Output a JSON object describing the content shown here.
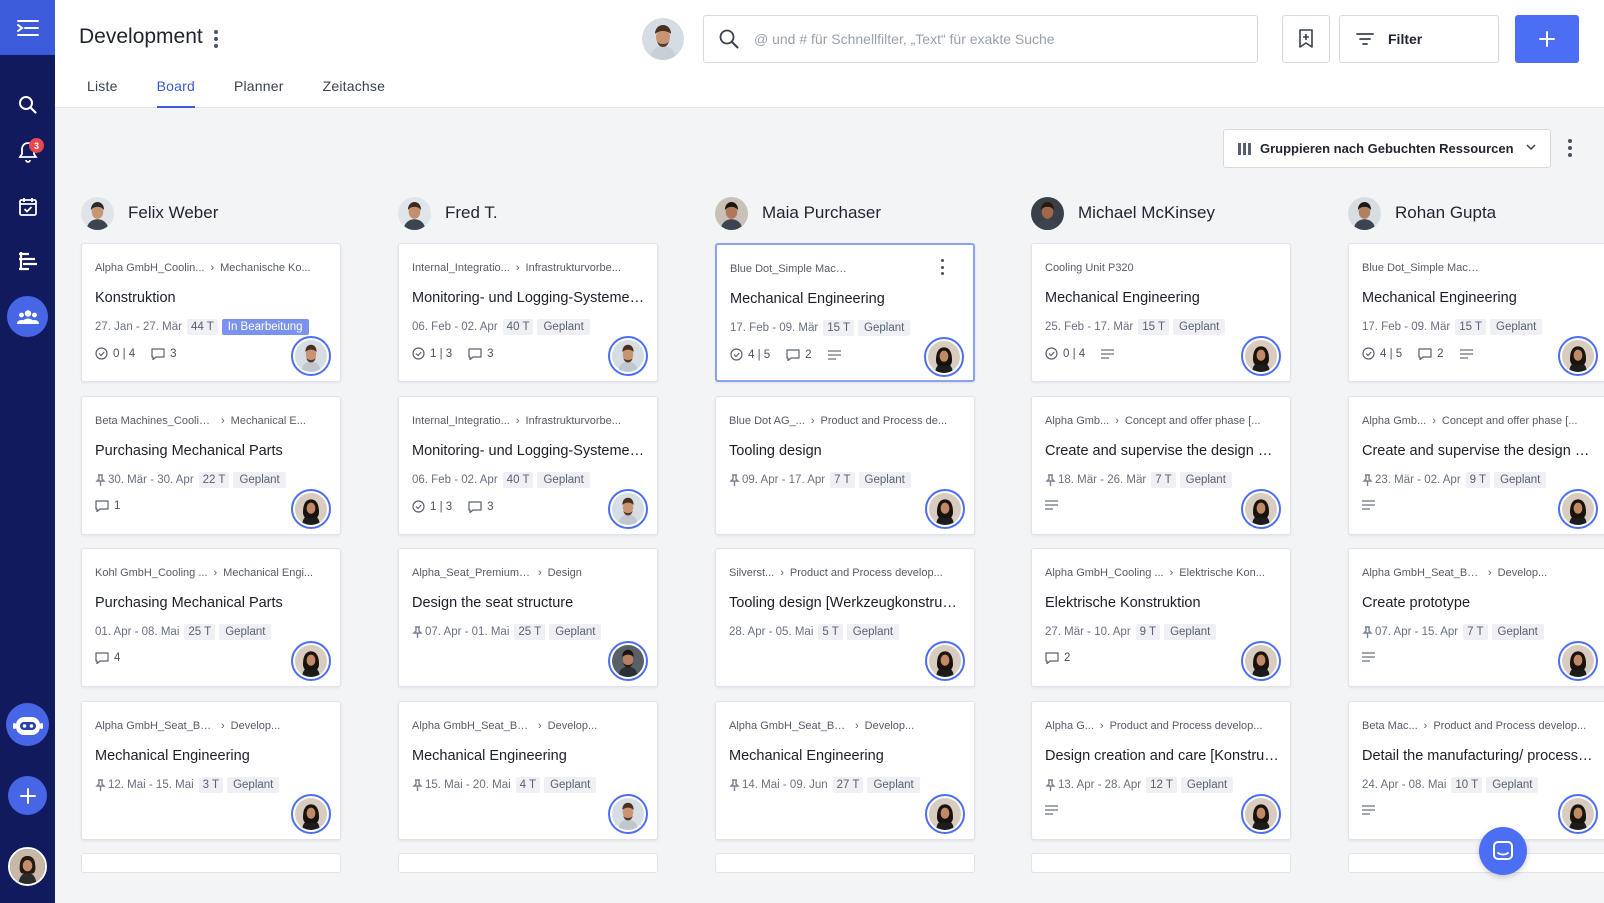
{
  "app": {
    "title": "Development",
    "search_placeholder": "@ und # für Schnellfilter, „Text“ für exakte Suche",
    "filter_label": "Filter",
    "notifications_count": "3",
    "tabs": [
      {
        "label": "Liste",
        "active": false
      },
      {
        "label": "Board",
        "active": true
      },
      {
        "label": "Planner",
        "active": false
      },
      {
        "label": "Zeitachse",
        "active": false
      }
    ],
    "group_by_label": "Gruppieren nach Gebuchten Ressourcen"
  },
  "colors": {
    "sidebar": "#101a5c",
    "accent": "#4c6ef5",
    "status_active": "#7b93ee"
  },
  "columns": [
    {
      "name": "Felix Weber",
      "cards": [
        {
          "crumb1": "Alpha GmbH_Coolin...",
          "crumb2": "Mechanische Ko...",
          "title": "Konstruktion",
          "pinned": false,
          "dates": "27. Jan - 27. Mär",
          "duration": "44 T",
          "status": "In Bearbeitung",
          "status_active": true,
          "checks": "0 | 4",
          "comments": "3",
          "notes": false
        },
        {
          "crumb1": "Beta Machines_Cooling ...",
          "crumb2": "Mechanical E...",
          "title": "Purchasing Mechanical Parts",
          "pinned": true,
          "dates": "30. Mär - 30. Apr",
          "duration": "22 T",
          "status": "Geplant",
          "checks": "",
          "comments": "1",
          "notes": false
        },
        {
          "crumb1": "Kohl GmbH_Cooling ...",
          "crumb2": "Mechanical Engi...",
          "title": "Purchasing Mechanical Parts",
          "pinned": false,
          "dates": "01. Apr - 08. Mai",
          "duration": "25 T",
          "status": "Geplant",
          "checks": "",
          "comments": "4",
          "notes": false
        },
        {
          "crumb1": "Alpha GmbH_Seat_Business_...",
          "crumb2": "Develop...",
          "title": "Mechanical Engineering",
          "pinned": true,
          "dates": "12. Mai - 15. Mai",
          "duration": "3 T",
          "status": "Geplant",
          "checks": "",
          "comments": "",
          "notes": false
        }
      ]
    },
    {
      "name": "Fred T.",
      "cards": [
        {
          "crumb1": "Internal_Integratio...",
          "crumb2": "Infrastrukturvorbe...",
          "title": "Monitoring- und Logging-Systeme einrichten",
          "pinned": false,
          "dates": "06. Feb - 02. Apr",
          "duration": "40 T",
          "status": "Geplant",
          "checks": "1 | 3",
          "comments": "3",
          "notes": false
        },
        {
          "crumb1": "Internal_Integratio...",
          "crumb2": "Infrastrukturvorbe...",
          "title": "Monitoring- und Logging-Systeme einrichten",
          "pinned": false,
          "dates": "06. Feb - 02. Apr",
          "duration": "40 T",
          "status": "Geplant",
          "checks": "1 | 3",
          "comments": "3",
          "notes": false
        },
        {
          "crumb1": "Alpha_Seat_Premium_Z300",
          "crumb2": "Design",
          "title": "Design the seat structure",
          "pinned": true,
          "dates": "07. Apr - 01. Mai",
          "duration": "25 T",
          "status": "Geplant",
          "checks": "",
          "comments": "",
          "notes": false
        },
        {
          "crumb1": "Alpha GmbH_Seat_Business_...",
          "crumb2": "Develop...",
          "title": "Mechanical Engineering",
          "pinned": true,
          "dates": "15. Mai - 20. Mai",
          "duration": "4 T",
          "status": "Geplant",
          "checks": "",
          "comments": "",
          "notes": false
        }
      ]
    },
    {
      "name": "Maia Purchaser",
      "cards": [
        {
          "crumb1": "Blue Dot_Simple Machine_400",
          "crumb2": "",
          "title": "Mechanical Engineering",
          "pinned": false,
          "dates": "17. Feb - 09. Mär",
          "duration": "15 T",
          "status": "Geplant",
          "checks": "4 | 5",
          "comments": "2",
          "notes": true,
          "selected": true
        },
        {
          "crumb1": "Blue Dot AG_...",
          "crumb2": "Product and Process de...",
          "title": "Tooling design",
          "pinned": true,
          "dates": "09. Apr - 17. Apr",
          "duration": "7 T",
          "status": "Geplant",
          "checks": "",
          "comments": "",
          "notes": false
        },
        {
          "crumb1": "Silverst...",
          "crumb2": "Product and Process develop...",
          "title": "Tooling design [Werkzeugkonstruktion]",
          "pinned": false,
          "dates": "28. Apr - 05. Mai",
          "duration": "5 T",
          "status": "Geplant",
          "checks": "",
          "comments": "",
          "notes": false
        },
        {
          "crumb1": "Alpha GmbH_Seat_Business_...",
          "crumb2": "Develop...",
          "title": "Mechanical Engineering",
          "pinned": true,
          "dates": "14. Mai - 09. Jun",
          "duration": "27 T",
          "status": "Geplant",
          "checks": "",
          "comments": "",
          "notes": false
        }
      ]
    },
    {
      "name": "Michael McKinsey",
      "cards": [
        {
          "crumb1": "Cooling Unit P320",
          "crumb2": "",
          "title": "Mechanical Engineering",
          "pinned": false,
          "dates": "25. Feb - 17. Mär",
          "duration": "15 T",
          "status": "Geplant",
          "checks": "0 | 4",
          "comments": "",
          "notes": true
        },
        {
          "crumb1": "Alpha Gmb...",
          "crumb2": "Concept and offer phase [...",
          "title": "Create and supervise the design concept",
          "pinned": true,
          "dates": "18. Mär - 26. Mär",
          "duration": "7 T",
          "status": "Geplant",
          "checks": "",
          "comments": "",
          "notes": true
        },
        {
          "crumb1": "Alpha GmbH_Cooling ...",
          "crumb2": "Elektrische Kon...",
          "title": "Elektrische Konstruktion",
          "pinned": false,
          "dates": "27. Mär - 10. Apr",
          "duration": "9 T",
          "status": "Geplant",
          "checks": "",
          "comments": "2",
          "notes": false
        },
        {
          "crumb1": "Alpha G...",
          "crumb2": "Product and Process develop...",
          "title": "Design creation and care [Konstruktion]",
          "pinned": true,
          "dates": "13. Apr - 28. Apr",
          "duration": "12 T",
          "status": "Geplant",
          "checks": "",
          "comments": "",
          "notes": true
        }
      ]
    },
    {
      "name": "Rohan Gupta",
      "cards": [
        {
          "crumb1": "Blue Dot_Simple Machine_400",
          "crumb2": "",
          "title": "Mechanical Engineering",
          "pinned": false,
          "dates": "17. Feb - 09. Mär",
          "duration": "15 T",
          "status": "Geplant",
          "checks": "4 | 5",
          "comments": "2",
          "notes": true
        },
        {
          "crumb1": "Alpha Gmb...",
          "crumb2": "Concept and offer phase [...",
          "title": "Create and supervise the design concept",
          "pinned": true,
          "dates": "23. Mär - 02. Apr",
          "duration": "9 T",
          "status": "Geplant",
          "checks": "",
          "comments": "",
          "notes": true
        },
        {
          "crumb1": "Alpha GmbH_Seat_Business_...",
          "crumb2": "Develop...",
          "title": "Create prototype",
          "pinned": true,
          "dates": "07. Apr - 15. Apr",
          "duration": "7 T",
          "status": "Geplant",
          "checks": "",
          "comments": "",
          "notes": true
        },
        {
          "crumb1": "Beta Mac...",
          "crumb2": "Product and Process develop...",
          "title": "Detail the manufacturing/ process design",
          "pinned": false,
          "dates": "24. Apr - 08. Mai",
          "duration": "10 T",
          "status": "Geplant",
          "checks": "",
          "comments": "",
          "notes": true
        }
      ]
    }
  ]
}
